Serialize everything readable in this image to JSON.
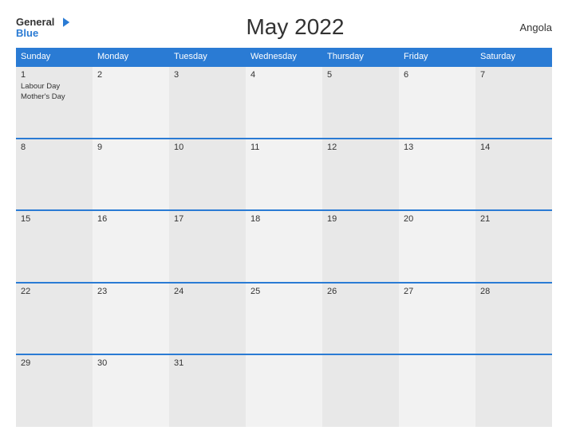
{
  "header": {
    "logo": {
      "general": "General",
      "blue": "Blue",
      "flag_title": "General Blue Logo"
    },
    "title": "May 2022",
    "country": "Angola"
  },
  "calendar": {
    "days_of_week": [
      "Sunday",
      "Monday",
      "Tuesday",
      "Wednesday",
      "Thursday",
      "Friday",
      "Saturday"
    ],
    "weeks": [
      [
        {
          "day": "1",
          "events": [
            "Labour Day",
            "Mother's Day"
          ]
        },
        {
          "day": "2",
          "events": []
        },
        {
          "day": "3",
          "events": []
        },
        {
          "day": "4",
          "events": []
        },
        {
          "day": "5",
          "events": []
        },
        {
          "day": "6",
          "events": []
        },
        {
          "day": "7",
          "events": []
        }
      ],
      [
        {
          "day": "8",
          "events": []
        },
        {
          "day": "9",
          "events": []
        },
        {
          "day": "10",
          "events": []
        },
        {
          "day": "11",
          "events": []
        },
        {
          "day": "12",
          "events": []
        },
        {
          "day": "13",
          "events": []
        },
        {
          "day": "14",
          "events": []
        }
      ],
      [
        {
          "day": "15",
          "events": []
        },
        {
          "day": "16",
          "events": []
        },
        {
          "day": "17",
          "events": []
        },
        {
          "day": "18",
          "events": []
        },
        {
          "day": "19",
          "events": []
        },
        {
          "day": "20",
          "events": []
        },
        {
          "day": "21",
          "events": []
        }
      ],
      [
        {
          "day": "22",
          "events": []
        },
        {
          "day": "23",
          "events": []
        },
        {
          "day": "24",
          "events": []
        },
        {
          "day": "25",
          "events": []
        },
        {
          "day": "26",
          "events": []
        },
        {
          "day": "27",
          "events": []
        },
        {
          "day": "28",
          "events": []
        }
      ],
      [
        {
          "day": "29",
          "events": []
        },
        {
          "day": "30",
          "events": []
        },
        {
          "day": "31",
          "events": []
        },
        {
          "day": "",
          "events": []
        },
        {
          "day": "",
          "events": []
        },
        {
          "day": "",
          "events": []
        },
        {
          "day": "",
          "events": []
        }
      ]
    ]
  }
}
